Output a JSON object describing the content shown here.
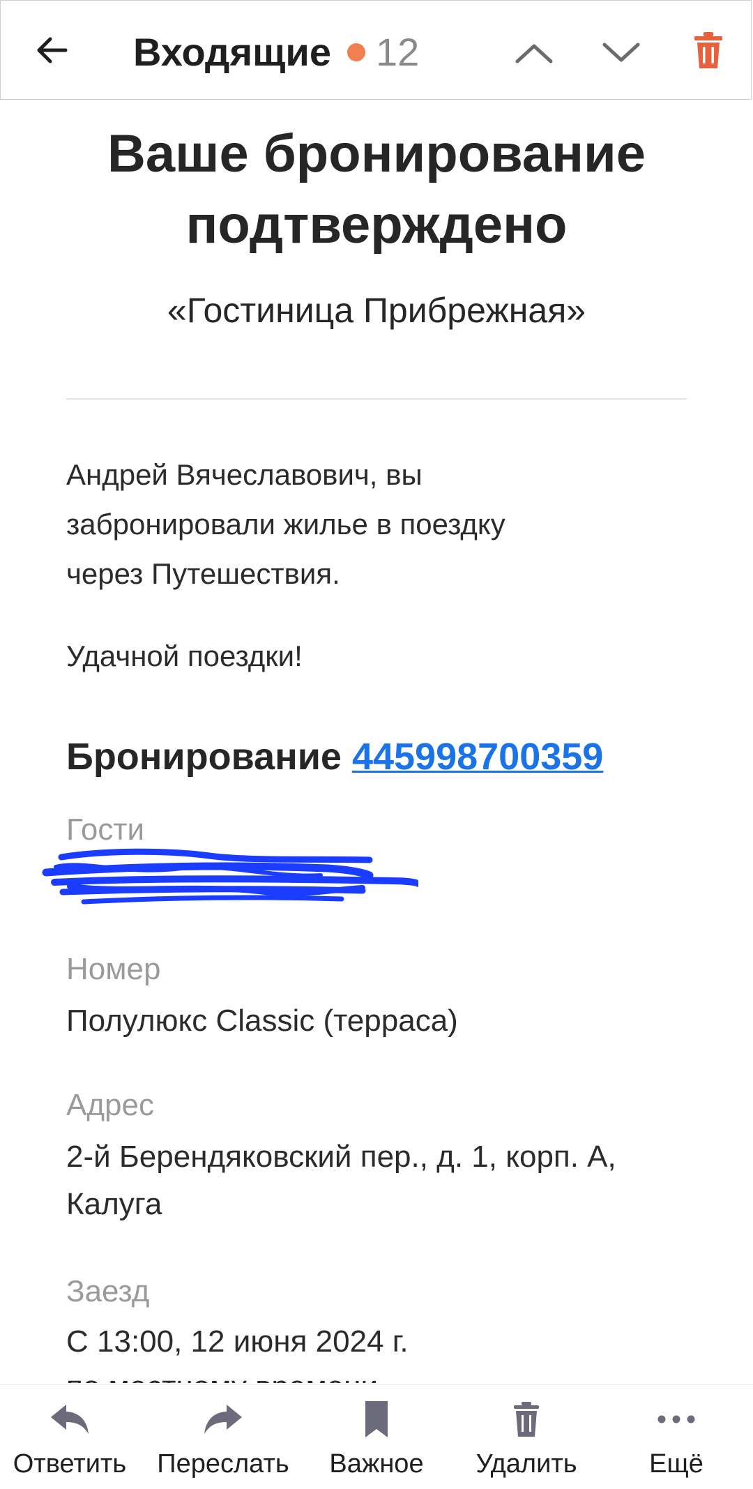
{
  "header": {
    "back_icon": "arrow-left-icon",
    "folder_title": "Входящие",
    "unread_dot_color": "#f08050",
    "unread_count": "12",
    "prev_icon": "chevron-up-icon",
    "next_icon": "chevron-down-icon",
    "delete_icon": "trash-icon",
    "delete_icon_color": "#e8613c"
  },
  "email": {
    "headline_line1": "Ваше бронирование",
    "headline_line2": "подтверждено",
    "hotel_name": "«Гостиница Прибрежная»",
    "greeting_line1": "Андрей Вячеславович, вы",
    "greeting_line2": "забронировали жилье в поездку",
    "greeting_line3": "через Путешествия.",
    "wish": "Удачной поездки!",
    "booking_label": "Бронирование",
    "booking_number": "445998700359",
    "link_color": "#1a73e8",
    "fields": {
      "guests_label": "Гости",
      "room_label": "Номер",
      "room_value": "Полулюкс Classic (терраса)",
      "address_label": "Адрес",
      "address_line1": "2-й Берендяковский пер., д. 1, корп. А,",
      "address_line2": "Калуга",
      "checkin_label": "Заезд",
      "checkin_value": "С 13:00, 12 июня 2024 г.",
      "checkin_note": "по местному времени"
    }
  },
  "bottom_bar": {
    "reply": {
      "icon": "reply-icon",
      "label": "Ответить"
    },
    "forward": {
      "icon": "forward-icon",
      "label": "Переслать"
    },
    "important": {
      "icon": "bookmark-icon",
      "label": "Важное"
    },
    "delete": {
      "icon": "trash-icon",
      "label": "Удалить"
    },
    "more": {
      "icon": "more-dots-icon",
      "label": "Ещё"
    },
    "icon_color": "#6b6b7b"
  }
}
